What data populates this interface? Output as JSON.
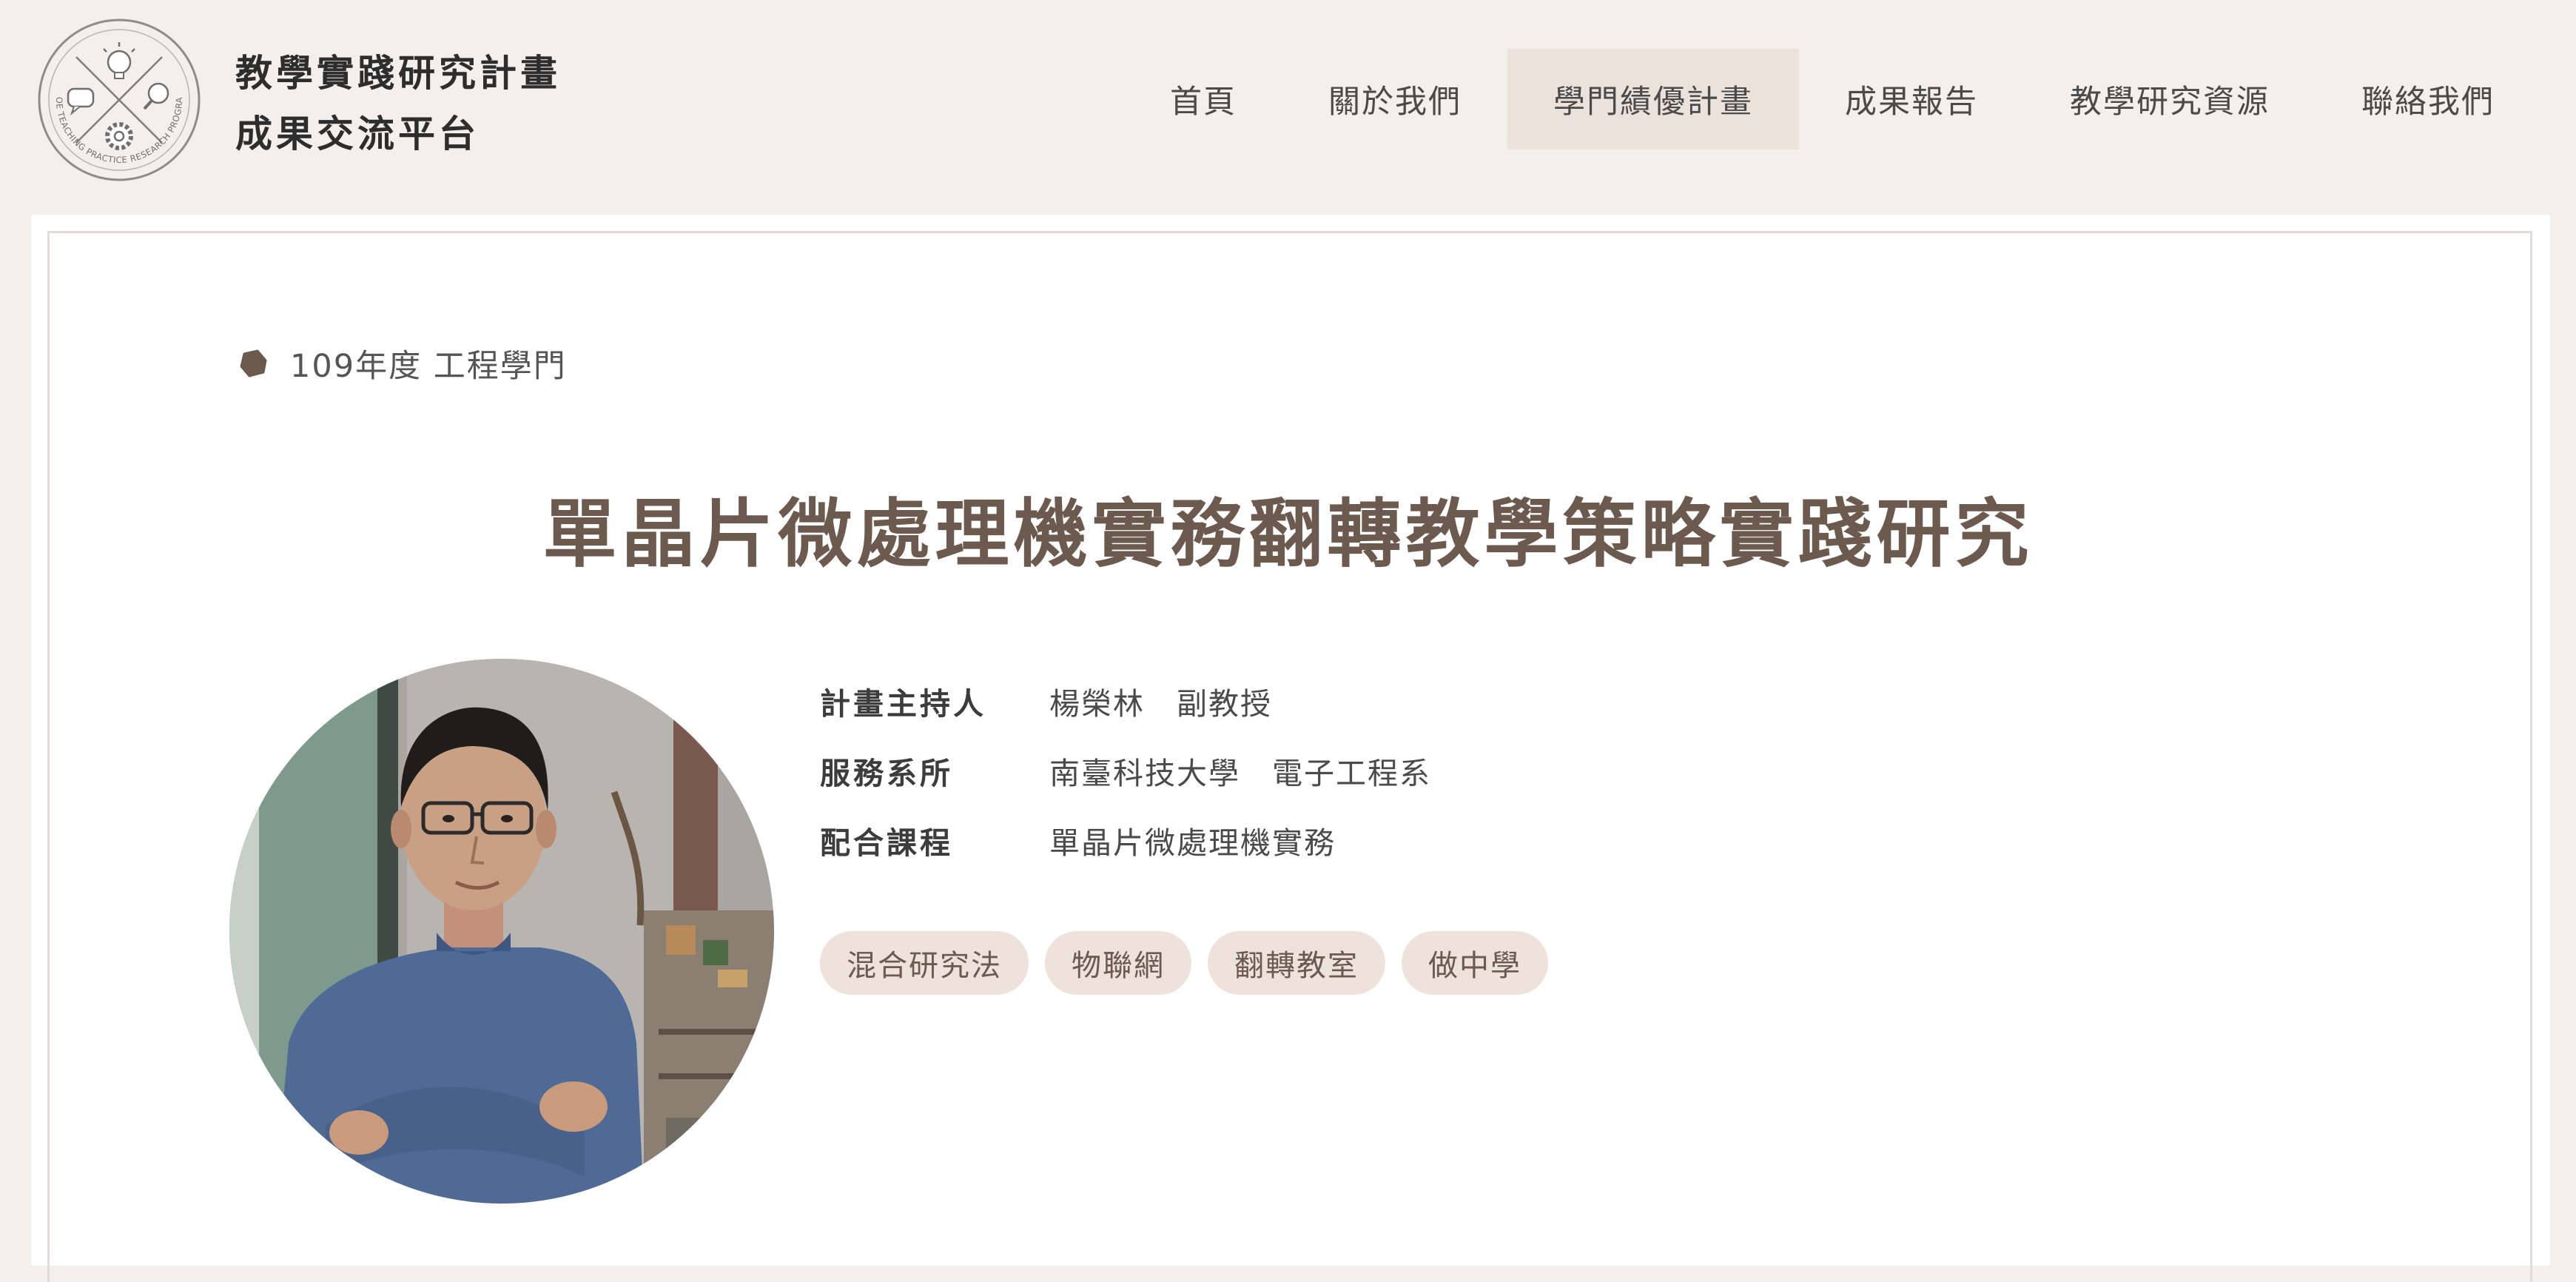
{
  "brand": {
    "line1": "教學實踐研究計畫",
    "line2": "成果交流平台",
    "badge_text": "MOE TEACHING PRACTICE RESEARCH PROGRAM"
  },
  "nav": {
    "items": [
      {
        "label": "首頁"
      },
      {
        "label": "關於我們"
      },
      {
        "label": "學門績優計畫"
      },
      {
        "label": "成果報告"
      },
      {
        "label": "教學研究資源"
      },
      {
        "label": "聯絡我們"
      }
    ],
    "active_label": "學門績優計畫"
  },
  "category": {
    "text": "109年度 工程學門"
  },
  "project": {
    "title": "單晶片微處理機實務翻轉教學策略實踐研究",
    "fields": [
      {
        "label": "計畫主持人",
        "value": "楊榮林　副教授"
      },
      {
        "label": "服務系所",
        "value": "南臺科技大學　電子工程系"
      },
      {
        "label": "配合課程",
        "value": "單晶片微處理機實務"
      }
    ],
    "tags": [
      "混合研究法",
      "物聯網",
      "翻轉教室",
      "做中學"
    ]
  },
  "colors": {
    "page_bg": "#f3efec",
    "card_bg": "#ffffff",
    "accent_brown": "#6b5a4d",
    "tag_bg": "#ede3dc",
    "nav_active_bg": "#ebe2dc"
  },
  "icons": {
    "logo": "teaching-badge-icon",
    "category": "hexagon-bullet-icon"
  }
}
